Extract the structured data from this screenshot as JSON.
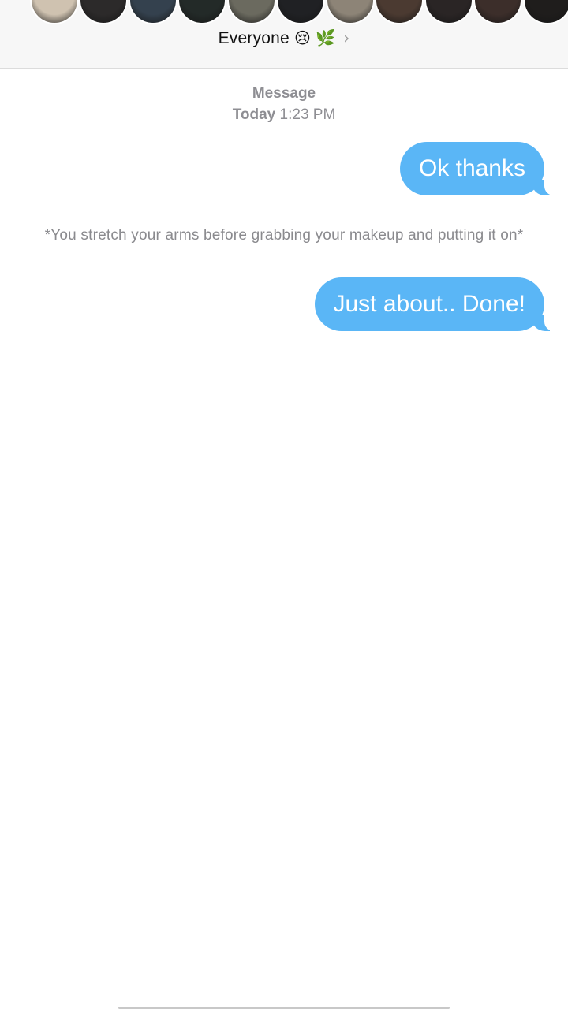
{
  "header": {
    "group_name": "Everyone",
    "emoji_1": "😢",
    "emoji_2": "🌿",
    "chevron": "›",
    "avatar_colors": [
      "#cfc2b0",
      "#2c2a2a",
      "#34414e",
      "#232a28",
      "#6b6a5f",
      "#202124",
      "#8d8477",
      "#4b3a31",
      "#2a2525",
      "#3c2e2a",
      "#1f1d1c",
      "#7a6354"
    ]
  },
  "thread": {
    "timestamp": {
      "label": "Message",
      "day": "Today",
      "time": "1:23 PM"
    },
    "messages": [
      {
        "text": "Ok thanks"
      },
      {
        "narration": "*You stretch your arms before grabbing your makeup and putting it on*"
      },
      {
        "text": "Just about.. Done!"
      }
    ]
  },
  "colors": {
    "bubble": "#5ab6f6",
    "meta_text": "#8e8e93"
  }
}
